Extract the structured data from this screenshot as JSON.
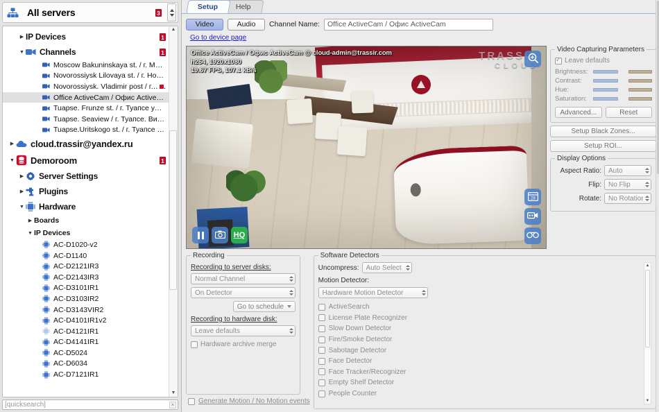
{
  "sidebar": {
    "header": {
      "title": "All servers",
      "badge": "3",
      "icon": "servers-icon"
    },
    "tree": [
      {
        "label": "IP Devices",
        "level": "mid",
        "arrow": "collapsed",
        "icon": "none",
        "badge": "1"
      },
      {
        "label": "Channels",
        "level": "mid",
        "arrow": "expanded",
        "icon": "camera-group-icon",
        "badge": "1"
      },
      {
        "label": "Moscow Bakuninskaya st. / г. Моск...",
        "level": "leaf",
        "arrow": "none",
        "icon": "camera-icon"
      },
      {
        "label": "Novorossiysk Lilovaya st. / г. Новор...",
        "level": "leaf",
        "arrow": "none",
        "icon": "camera-icon"
      },
      {
        "label": "Novorossiysk. Vladimir post / г. Нов",
        "level": "leaf",
        "arrow": "none",
        "icon": "camera-icon",
        "status": "red"
      },
      {
        "label": "Office ActiveCam / Офис ActiveCam",
        "level": "leaf",
        "arrow": "none",
        "icon": "camera-icon",
        "selected": true
      },
      {
        "label": "Tuapse. Frunze st. / г. Туапсе ул.Ф...",
        "level": "leaf",
        "arrow": "none",
        "icon": "camera-icon"
      },
      {
        "label": "Tuapse. Seaview / г. Туапсе. Вид н...",
        "level": "leaf",
        "arrow": "none",
        "icon": "camera-icon"
      },
      {
        "label": "Tuapse.Uritskogo st. / г. Туапсе ул....",
        "level": "leaf",
        "arrow": "none",
        "icon": "camera-icon"
      },
      {
        "label": "cloud.trassir@yandex.ru",
        "level": "big",
        "arrow": "collapsed",
        "icon": "cloud-icon"
      },
      {
        "label": "Demoroom",
        "level": "big",
        "arrow": "expanded",
        "icon": "server-icon",
        "badge": "1"
      },
      {
        "label": "Server Settings",
        "level": "mid",
        "arrow": "collapsed",
        "icon": "gear-icon"
      },
      {
        "label": "Plugins",
        "level": "mid",
        "arrow": "collapsed",
        "icon": "puzzle-icon"
      },
      {
        "label": "Hardware",
        "level": "mid",
        "arrow": "expanded",
        "icon": "chip-icon"
      },
      {
        "label": "Boards",
        "level": "sub",
        "arrow": "collapsed",
        "icon": "none"
      },
      {
        "label": "IP Devices",
        "level": "sub",
        "arrow": "expanded",
        "icon": "none"
      },
      {
        "label": "AC-D1020-v2",
        "level": "leaf",
        "arrow": "none",
        "icon": "device-icon"
      },
      {
        "label": "AC-D1140",
        "level": "leaf",
        "arrow": "none",
        "icon": "device-icon"
      },
      {
        "label": "AC-D2121IR3",
        "level": "leaf",
        "arrow": "none",
        "icon": "device-icon"
      },
      {
        "label": "AC-D2143IR3",
        "level": "leaf",
        "arrow": "none",
        "icon": "device-icon"
      },
      {
        "label": "AC-D3101IR1",
        "level": "leaf",
        "arrow": "none",
        "icon": "device-icon"
      },
      {
        "label": "AC-D3103IR2",
        "level": "leaf",
        "arrow": "none",
        "icon": "device-icon"
      },
      {
        "label": "AC-D3143VIR2",
        "level": "leaf",
        "arrow": "none",
        "icon": "device-icon"
      },
      {
        "label": "AC-D4101IR1v2",
        "level": "leaf",
        "arrow": "none",
        "icon": "device-icon"
      },
      {
        "label": "AC-D4121IR1",
        "level": "leaf",
        "arrow": "none",
        "icon": "device-icon",
        "dim": true
      },
      {
        "label": "AC-D4141IR1",
        "level": "leaf",
        "arrow": "none",
        "icon": "device-icon"
      },
      {
        "label": "AC-D5024",
        "level": "leaf",
        "arrow": "none",
        "icon": "device-icon"
      },
      {
        "label": "AC-D6034",
        "level": "leaf",
        "arrow": "none",
        "icon": "device-icon"
      },
      {
        "label": "AC-D7121IR1",
        "level": "leaf",
        "arrow": "none",
        "icon": "device-icon"
      }
    ],
    "quicksearch": {
      "placeholder": "[quicksearch]",
      "value": "[quicksearch]",
      "clear": "×"
    }
  },
  "tabs": [
    {
      "label": "Setup",
      "active": true
    },
    {
      "label": "Help",
      "active": false
    }
  ],
  "toolbar": {
    "video_label": "Video",
    "audio_label": "Audio",
    "channel_name_label": "Channel Name:",
    "channel_name_value": "Office ActiveCam / Офис ActiveCam",
    "device_page_link": "Go to device page"
  },
  "video": {
    "osd_line1": "Office ActiveCam / Офис ActiveCam @ cloud-admin@trassir.com",
    "osd_line2": "h264, 1920x1080",
    "osd_line3": "19.67 FPS, 107.1 kB/s",
    "watermark_main": "TRASSIR",
    "watermark_sub": "CLOUD",
    "hq_label": "HQ",
    "calendar_day": "28",
    "controls": {
      "pause": "pause-icon",
      "snapshot": "camera-snapshot-icon",
      "quality": "hq-toggle",
      "zoom": "magnifier-icon",
      "calendar": "calendar-icon",
      "record": "video-camera-icon",
      "audio": "audio-icon"
    }
  },
  "capture": {
    "legend": "Video Capturing Parameters",
    "leave_defaults": "Leave defaults",
    "leave_defaults_checked": true,
    "sliders": [
      {
        "label": "Brightness:"
      },
      {
        "label": "Contrast:"
      },
      {
        "label": "Hue:"
      },
      {
        "label": "Saturation:"
      }
    ],
    "advanced_label": "Advanced...",
    "reset_label": "Reset",
    "black_zones_label": "Setup Black Zones...",
    "roi_label": "Setup ROI..."
  },
  "display": {
    "legend": "Display Options",
    "rows": [
      {
        "label": "Aspect Ratio:",
        "value": "Auto"
      },
      {
        "label": "Flip:",
        "value": "No Flip"
      },
      {
        "label": "Rotate:",
        "value": "No Rotation"
      }
    ]
  },
  "recording": {
    "legend": "Recording",
    "server_disks_label": "Recording to server disks:",
    "channel_mode": "Normal Channel",
    "trigger_mode": "On Detector",
    "schedule_label": "Go to schedule",
    "hardware_disk_label": "Recording to hardware disk:",
    "hardware_disk_value": "Leave defaults",
    "hw_merge_label": "Hardware archive merge",
    "hw_merge_checked": false,
    "generate_motion_label": "Generate Motion / No Motion events",
    "generate_motion_checked": false
  },
  "detectors": {
    "legend": "Software Detectors",
    "uncompress_label": "Uncompress:",
    "uncompress_value": "Auto Select",
    "motion_detector_label": "Motion Detector:",
    "motion_detector_value": "Hardware Motion Detector",
    "items": [
      {
        "label": "ActiveSearch",
        "checked": false
      },
      {
        "label": "License Plate Recognizer",
        "checked": false
      },
      {
        "label": "Slow Down Detector",
        "checked": false
      },
      {
        "label": "Fire/Smoke Detector",
        "checked": false
      },
      {
        "label": "Sabotage Detector",
        "checked": false
      },
      {
        "label": "Face Detector",
        "checked": false
      },
      {
        "label": "Face Tracker/Recognizer",
        "checked": false
      },
      {
        "label": "Empty Shelf Detector",
        "checked": false
      },
      {
        "label": "People Counter",
        "checked": false
      }
    ]
  },
  "colors": {
    "accent_blue": "#4a7ec8",
    "badge_red": "#c8102e",
    "tab_active_text": "#2b4a88",
    "link_blue": "#1a1ad0",
    "hq_green": "#2bad4e"
  }
}
